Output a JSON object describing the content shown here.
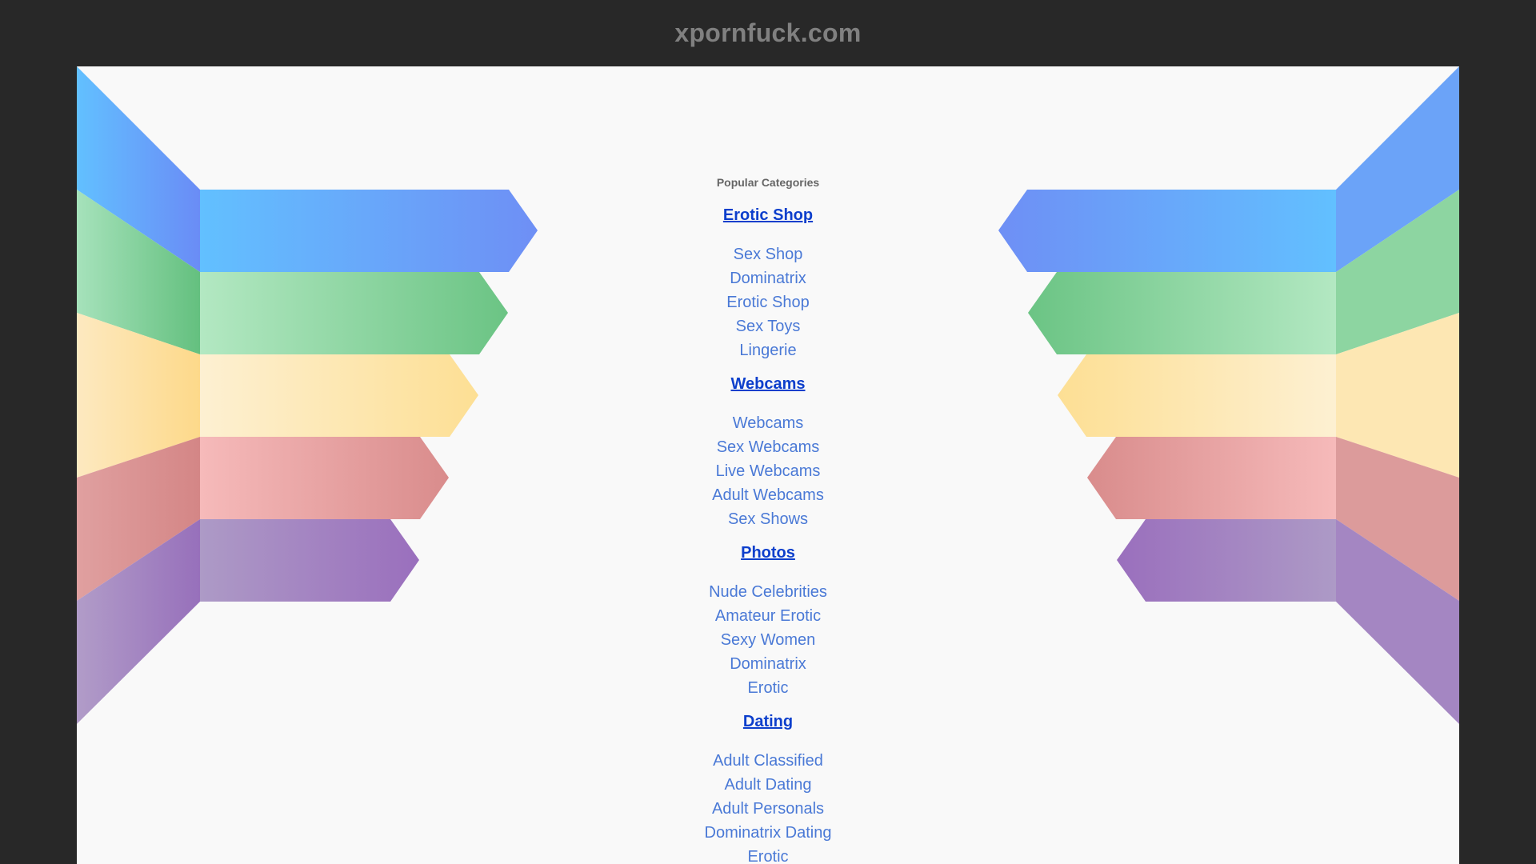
{
  "site": {
    "title": "xpornfuck.com"
  },
  "categories": {
    "heading": "Popular Categories",
    "groups": [
      {
        "title": "Erotic Shop",
        "links": [
          "Sex Shop",
          "Dominatrix",
          "Erotic Shop",
          "Sex Toys",
          "Lingerie"
        ]
      },
      {
        "title": "Webcams",
        "links": [
          "Webcams",
          "Sex Webcams",
          "Live Webcams",
          "Adult Webcams",
          "Sex Shows"
        ]
      },
      {
        "title": "Photos",
        "links": [
          "Nude Celebrities",
          "Amateur Erotic",
          "Sexy Women",
          "Dominatrix",
          "Erotic"
        ]
      },
      {
        "title": "Dating",
        "links": [
          "Adult Classified",
          "Adult Dating",
          "Adult Personals",
          "Dominatrix Dating",
          "Erotic"
        ]
      }
    ]
  },
  "colors": {
    "background": "#282828",
    "panel": "#f9f9f9",
    "heading_link": "#0d3fcc",
    "link": "#4a79d6",
    "banner_blue": "#62b8fb",
    "banner_green": "#6fc68a",
    "banner_yellow": "#fde19a",
    "banner_red": "#f2b5b5",
    "banner_purple": "#9b6fbc"
  }
}
